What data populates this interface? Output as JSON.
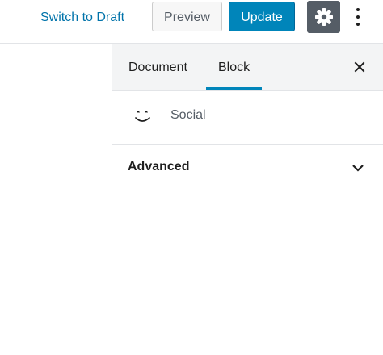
{
  "header": {
    "switch_to_draft_label": "Switch to Draft",
    "preview_label": "Preview",
    "update_label": "Update",
    "settings_icon": "gear-icon",
    "more_icon": "vertical-ellipsis-icon"
  },
  "sidebar": {
    "tabs": [
      {
        "label": "Document",
        "active": false
      },
      {
        "label": "Block",
        "active": true
      }
    ],
    "close_icon": "close-icon",
    "block": {
      "icon": "smiley-icon",
      "title": "Social"
    },
    "panels": [
      {
        "title": "Advanced",
        "expanded": false,
        "icon": "chevron-down-icon"
      }
    ]
  },
  "colors": {
    "accent": "#0085ba",
    "link": "#0073aa",
    "settings_bg": "#555d66",
    "tabs_bg": "#f3f4f5",
    "border": "#e2e4e7"
  }
}
